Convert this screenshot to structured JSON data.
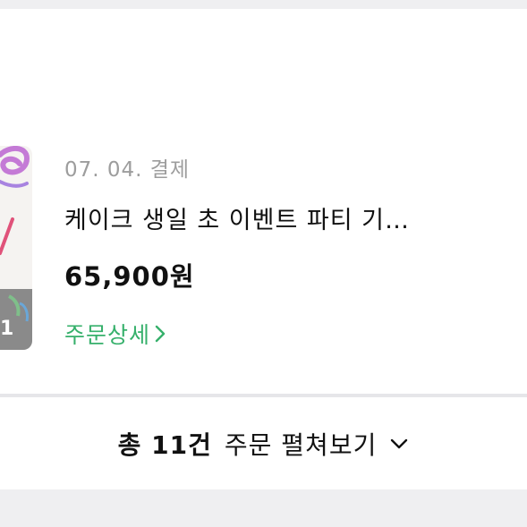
{
  "order": {
    "date": "07. 04. 결제",
    "title": "케이크 생일 초 이벤트 파티 기…",
    "price": "65,900원",
    "detail_label": "주문상세",
    "thumbnail_count": "1",
    "thumbnail_icon": "product-thumbnail"
  },
  "expand": {
    "total_label": "총 11건",
    "action_label": "주문 펼쳐보기",
    "icon": "chevron-down-icon"
  },
  "colors": {
    "accent_green": "#36b06b",
    "date_gray": "#9d9d9d",
    "background": "#efeff1"
  }
}
